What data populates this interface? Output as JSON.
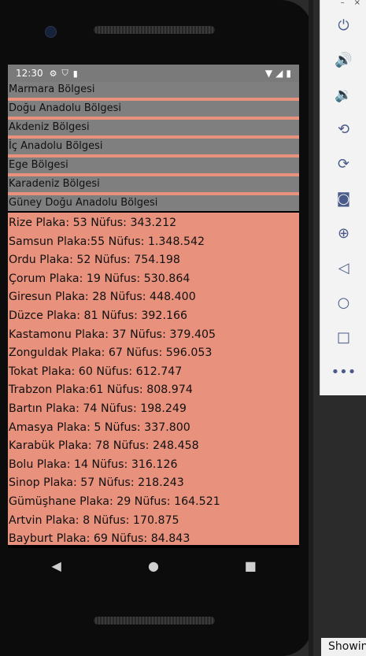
{
  "status_bar": {
    "time": "12:30",
    "icons": [
      "settings-icon",
      "shield-icon",
      "sim-card-icon"
    ],
    "right_icons": [
      "wifi-icon",
      "signal-icon",
      "battery-icon"
    ]
  },
  "regions": [
    {
      "label": "Marmara Bölgesi"
    },
    {
      "label": "Doğu Anadolu Bölgesi"
    },
    {
      "label": "Akdeniz Bölgesi"
    },
    {
      "label": "İç Anadolu Bölgesi"
    },
    {
      "label": "Ege Bölgesi"
    },
    {
      "label": "Karadeniz Bölgesi"
    },
    {
      "label": "Güney Doğu Anadolu Bölgesi"
    }
  ],
  "cities": [
    {
      "text": "Rize Plaka: 53 Nüfus: 343.212"
    },
    {
      "text": "Samsun Plaka:55 Nüfus: 1.348.542"
    },
    {
      "text": "Ordu Plaka: 52 Nüfus: 754.198"
    },
    {
      "text": "Çorum Plaka: 19 Nüfus: 530.864"
    },
    {
      "text": "Giresun Plaka: 28 Nüfus: 448.400"
    },
    {
      "text": "Düzce Plaka: 81 Nüfus: 392.166"
    },
    {
      "text": "Kastamonu Plaka: 37 Nüfus: 379.405"
    },
    {
      "text": "Zonguldak Plaka: 67 Nüfus: 596.053"
    },
    {
      "text": "Tokat Plaka: 60 Nüfus: 612.747"
    },
    {
      "text": "Trabzon Plaka:61 Nüfus: 808.974"
    },
    {
      "text": "Bartın Plaka: 74 Nüfus: 198.249"
    },
    {
      "text": "Amasya Plaka: 5 Nüfus: 337.800"
    },
    {
      "text": "Karabük Plaka: 78 Nüfus: 248.458"
    },
    {
      "text": "Bolu Plaka: 14 Nüfus: 316.126"
    },
    {
      "text": "Sinop Plaka: 57 Nüfus: 218.243"
    },
    {
      "text": "Gümüşhane Plaka: 29 Nüfus: 164.521"
    },
    {
      "text": "Artvin Plaka: 8 Nüfus: 170.875"
    },
    {
      "text": "Bayburt Plaka: 69 Nüfus: 84.843"
    }
  ],
  "nav_bar": {
    "icons": [
      "back-icon",
      "home-icon",
      "recents-icon"
    ]
  },
  "emulator_toolbar": {
    "buttons": [
      "power-icon",
      "volume-up-icon",
      "volume-down-icon",
      "rotate-left-icon",
      "rotate-right-icon",
      "camera-icon",
      "zoom-icon",
      "back-icon",
      "home-icon",
      "overview-icon",
      "more-icon"
    ],
    "window_controls": [
      "minimize-icon",
      "close-icon"
    ]
  },
  "bottom_tab": {
    "label": "Showin"
  },
  "colors": {
    "list_bg": "#e8917c",
    "region_bg": "#7f7f7f",
    "status_bar": "#7a7a7a"
  }
}
